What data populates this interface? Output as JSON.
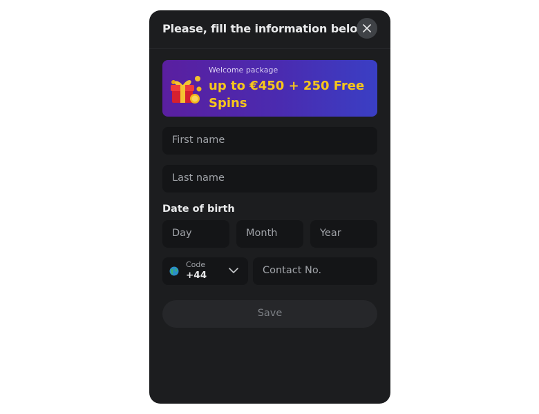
{
  "modal": {
    "title": "Please, fill the information below",
    "close_icon": "close-icon"
  },
  "promo": {
    "subtitle": "Welcome package",
    "headline": "up to €450 + 250 Free Spins",
    "icon": "gift-icon"
  },
  "form": {
    "first_name_placeholder": "First name",
    "last_name_placeholder": "Last name",
    "dob_label": "Date of birth",
    "day_placeholder": "Day",
    "month_placeholder": "Month",
    "year_placeholder": "Year",
    "code_label": "Code",
    "code_value": "+44",
    "contact_placeholder": "Contact No.",
    "save_label": "Save"
  },
  "colors": {
    "modal_bg": "#1c1d1f",
    "input_bg": "#141517",
    "promo_accent": "#f6c61b",
    "button_bg": "#26272a"
  }
}
